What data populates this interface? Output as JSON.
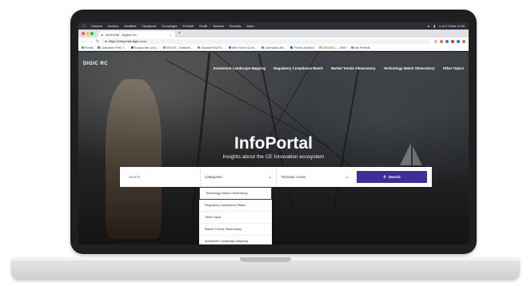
{
  "menubar": {
    "items": [
      "Chrome",
      "Archivo",
      "Modifica",
      "Visualizza",
      "Cronologia",
      "Preferiti",
      "Profili",
      "Scheda",
      "Finestra",
      "Aiuto"
    ],
    "status": "Lun 2 Ottob 11:30"
  },
  "browser": {
    "tab_title": "InfoPortal - Digitec Rc",
    "url": "https://infoportal.digic.rc.eu",
    "bookmarks": [
      "Portali",
      "Calendario PHD T...",
      "Scopus Bec of pr...",
      "ROUTE - Gestione...",
      "Giovani ROUTE...",
      "Web Server & Ins...",
      "Calendario Atti...",
      "Photos Dropbox",
      "DESIGN C... WEB",
      "Altri Preferiti"
    ],
    "colors": {
      "close": "#ff5f57",
      "min": "#febc2e",
      "max": "#28c840"
    }
  },
  "site": {
    "logo": "DIGIC RC",
    "logo_sub": "",
    "nav": [
      "Investment Landscape Mapping",
      "Regulatory Compliance Watch",
      "Market Trends Observatory",
      "Technology Watch Observatory",
      "Other Topics"
    ],
    "title": "InfoPortal",
    "subtitle": "Insights about the CE Innovation ecosystem",
    "search": {
      "placeholder": "Search",
      "category_label": "Categories",
      "area_label": "Thematic Areas",
      "button": "Search"
    },
    "dropdown_options": [
      "Technology Watch Observatory",
      "Regulatory Compliance Watch",
      "Other topics",
      "Market Trends Observatory",
      "Investment Landscape Mapping"
    ],
    "accent": "#3d2f9a"
  }
}
